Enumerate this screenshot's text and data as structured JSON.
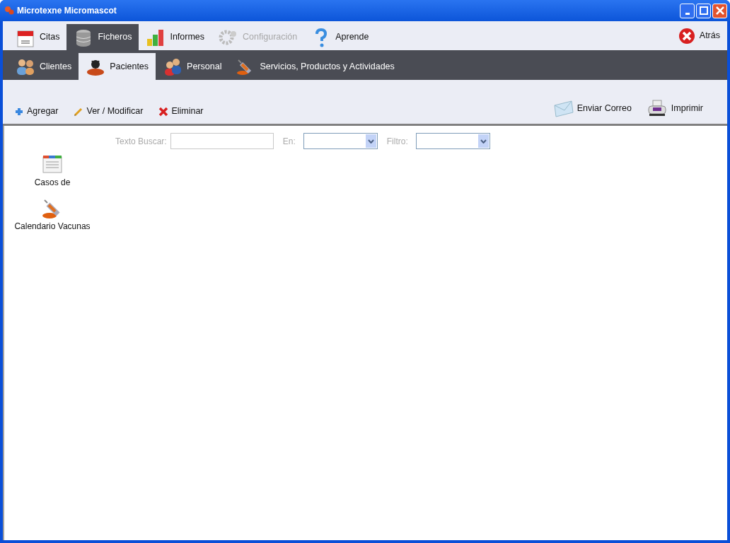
{
  "window": {
    "title": "Microtexne Micromascot"
  },
  "main_tabs": [
    {
      "label": "Citas",
      "selected": false,
      "disabled": false
    },
    {
      "label": "Ficheros",
      "selected": true,
      "disabled": false
    },
    {
      "label": "Informes",
      "selected": false,
      "disabled": false
    },
    {
      "label": "Configuración",
      "selected": false,
      "disabled": true
    },
    {
      "label": "Aprende",
      "selected": false,
      "disabled": false
    }
  ],
  "back_button": {
    "label": "Atrás"
  },
  "sub_tabs": [
    {
      "label": "Clientes",
      "selected": false
    },
    {
      "label": "Pacientes",
      "selected": true
    },
    {
      "label": "Personal",
      "selected": false
    },
    {
      "label": "Servicios, Productos y Actividades",
      "selected": false
    }
  ],
  "toolbar_left": [
    "Agregar",
    "Ver / Modificar",
    "Eliminar"
  ],
  "toolbar_right": [
    "Enviar Correo",
    "Imprimir"
  ],
  "search": {
    "label": "Texto Buscar:",
    "in_label": "En:",
    "filter_label": "Filtro:"
  },
  "shortcuts": [
    "Casos de",
    "Calendario Vacunas"
  ]
}
